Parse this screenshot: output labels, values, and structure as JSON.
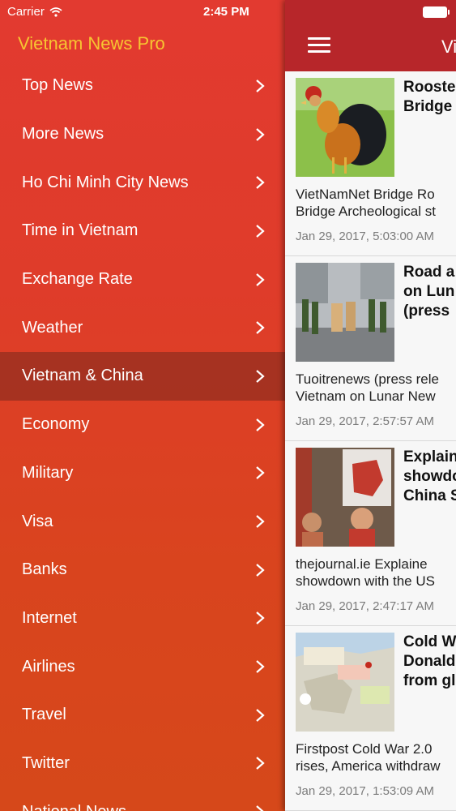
{
  "status_bar": {
    "carrier": "Carrier",
    "time": "2:45 PM"
  },
  "menu": {
    "title": "Vietnam News Pro",
    "items": [
      {
        "label": "Top News"
      },
      {
        "label": "More News"
      },
      {
        "label": "Ho Chi Minh City News"
      },
      {
        "label": "Time in Vietnam"
      },
      {
        "label": "Exchange Rate"
      },
      {
        "label": "Weather"
      },
      {
        "label": "Vietnam & China"
      },
      {
        "label": "Economy"
      },
      {
        "label": "Military"
      },
      {
        "label": "Visa"
      },
      {
        "label": "Banks"
      },
      {
        "label": "Internet"
      },
      {
        "label": "Airlines"
      },
      {
        "label": "Travel"
      },
      {
        "label": "Twitter"
      },
      {
        "label": "National News"
      }
    ],
    "active_index": 6
  },
  "main": {
    "title": "Vi",
    "articles": [
      {
        "headline_line1": "Rooste",
        "headline_line2": "Bridge",
        "headline_line3": "",
        "meta_line1": "VietNamNet Bridge    Ro",
        "meta_line2": "Bridge  Archeological st",
        "date": "Jan 29, 2017, 5:03:00 AM",
        "thumb_icon": "rooster-photo"
      },
      {
        "headline_line1": "Road a",
        "headline_line2": "on Lun",
        "headline_line3": "(press",
        "meta_line1": "Tuoitrenews (press rele",
        "meta_line2": "Vietnam on Lunar New",
        "date": "Jan 29, 2017, 2:57:57 AM",
        "thumb_icon": "street-parade-photo"
      },
      {
        "headline_line1": "Explain",
        "headline_line2": "showdo",
        "headline_line3": "China S",
        "meta_line1": "thejournal.ie    Explaine",
        "meta_line2": "showdown with the US",
        "date": "Jan 29, 2017, 2:47:17 AM",
        "thumb_icon": "protest-photo"
      },
      {
        "headline_line1": "Cold W",
        "headline_line2": "Donald",
        "headline_line3": "from gl",
        "meta_line1": "Firstpost    Cold War 2.0",
        "meta_line2": "rises, America withdraw",
        "date": "Jan 29, 2017, 1:53:09 AM",
        "thumb_icon": "map-photo"
      }
    ]
  },
  "colors": {
    "menu_gradient_top": "#e23a30",
    "menu_gradient_bottom": "#d6481a",
    "menu_title": "#f7c531",
    "header": "#b7262a",
    "active_row": "#8b3226"
  }
}
